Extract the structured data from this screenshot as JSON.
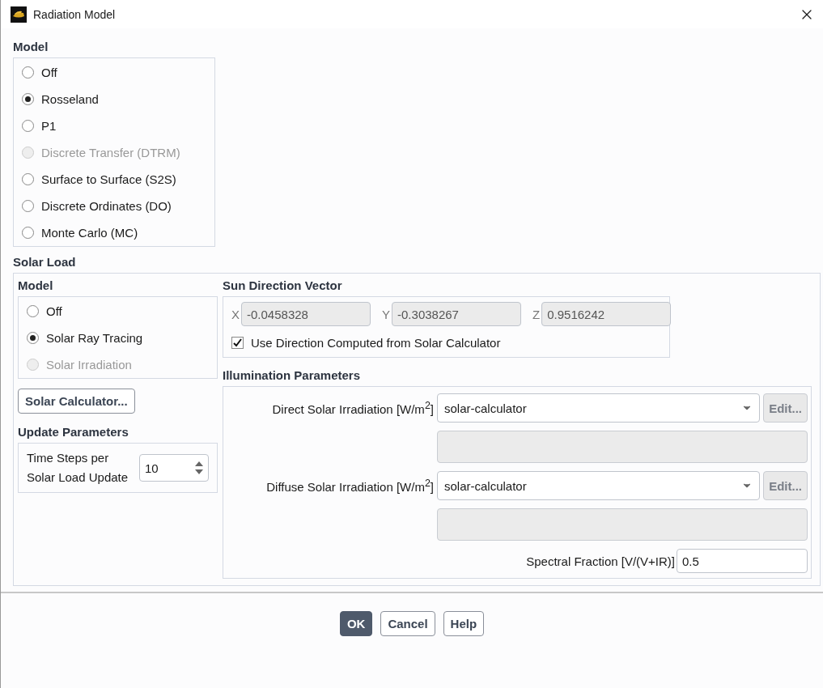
{
  "window": {
    "title": "Radiation Model"
  },
  "model": {
    "title": "Model",
    "options": [
      {
        "label": "Off",
        "selected": false,
        "disabled": false
      },
      {
        "label": "Rosseland",
        "selected": true,
        "disabled": false
      },
      {
        "label": "P1",
        "selected": false,
        "disabled": false
      },
      {
        "label": "Discrete Transfer (DTRM)",
        "selected": false,
        "disabled": true
      },
      {
        "label": "Surface to Surface (S2S)",
        "selected": false,
        "disabled": false
      },
      {
        "label": "Discrete Ordinates (DO)",
        "selected": false,
        "disabled": false
      },
      {
        "label": "Monte Carlo (MC)",
        "selected": false,
        "disabled": false
      }
    ]
  },
  "solar_load": {
    "title": "Solar Load",
    "model": {
      "title": "Model",
      "options": [
        {
          "label": "Off",
          "selected": false,
          "disabled": false
        },
        {
          "label": "Solar Ray Tracing",
          "selected": true,
          "disabled": false
        },
        {
          "label": "Solar Irradiation",
          "selected": false,
          "disabled": true
        }
      ]
    },
    "calculator_button": "Solar Calculator...",
    "update_parameters": {
      "title": "Update Parameters",
      "label": "Time Steps per Solar Load Update",
      "value": "10"
    },
    "sun_direction": {
      "title": "Sun Direction Vector",
      "fields": [
        {
          "axis": "X",
          "value": "-0.0458328"
        },
        {
          "axis": "Y",
          "value": "-0.3038267"
        },
        {
          "axis": "Z",
          "value": "0.9516242"
        }
      ],
      "checkbox": {
        "label": "Use Direction Computed from Solar Calculator",
        "checked": true
      }
    },
    "illumination": {
      "title": "Illumination Parameters",
      "rows": [
        {
          "label": "Direct Solar Irradiation [W/m$^{2}$]",
          "value": "solar-calculator",
          "edit": "Edit...",
          "edit_disabled": true
        },
        {
          "label": "Diffuse Solar Irradiation [W/m$^{2}$]",
          "value": "solar-calculator",
          "edit": "Edit...",
          "edit_disabled": true
        }
      ],
      "spectral": {
        "label": "Spectral Fraction [V/(V+IR)]",
        "value": "0.5"
      }
    }
  },
  "buttons": [
    {
      "label": "OK",
      "kind": "primary"
    },
    {
      "label": "Cancel",
      "kind": "normal"
    },
    {
      "label": "Help",
      "kind": "normal"
    }
  ]
}
